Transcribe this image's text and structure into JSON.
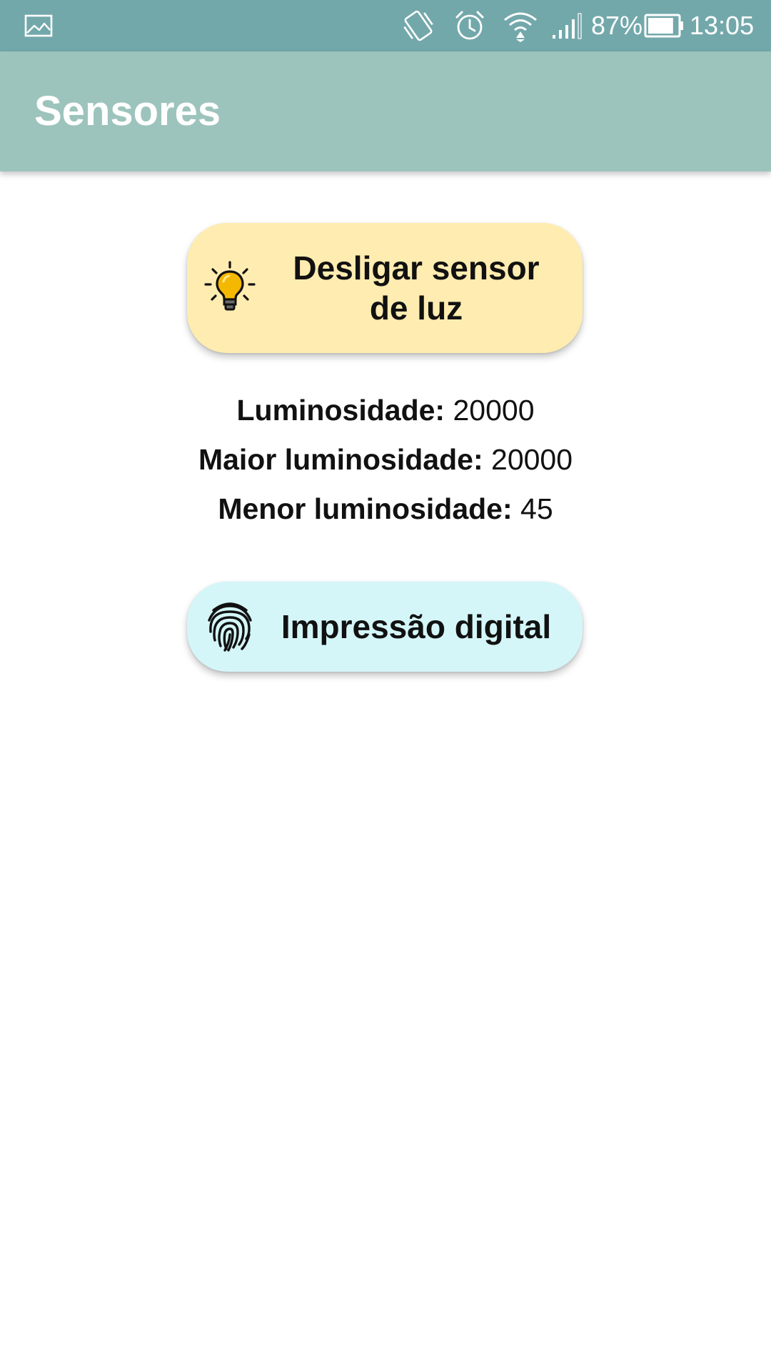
{
  "status_bar": {
    "battery_percent": "87%",
    "battery_level": 0.87,
    "time": "13:05",
    "icons": [
      "gallery-icon",
      "vibrate-icon",
      "alarm-icon",
      "wifi-icon",
      "signal-icon",
      "battery-icon"
    ]
  },
  "app_bar": {
    "title": "Sensores"
  },
  "light_button": {
    "label": "Desligar sensor de luz",
    "icon": "lightbulb-icon",
    "color": "#ffecb0"
  },
  "readings": {
    "luminosity": {
      "label": "Luminosidade:",
      "value": "20000"
    },
    "max_luminosity": {
      "label": "Maior luminosidade:",
      "value": "20000"
    },
    "min_luminosity": {
      "label": "Menor luminosidade:",
      "value": "45"
    }
  },
  "fingerprint_button": {
    "label": "Impressão digital",
    "icon": "fingerprint-icon",
    "color": "#d4f6f8"
  },
  "colors": {
    "status_bar": "#73a8ab",
    "app_bar": "#9dc4bc",
    "bulb": "#f5b800"
  }
}
